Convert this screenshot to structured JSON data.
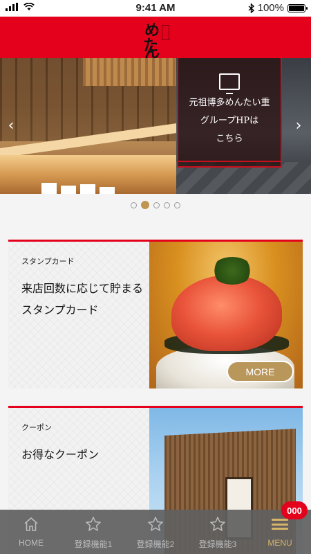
{
  "status_bar": {
    "time": "9:41 AM",
    "battery_percent": "100%"
  },
  "header": {
    "logo_text_1": "めん",
    "logo_text_2": "た重",
    "brand_color": "#e4011b"
  },
  "banner": {
    "overlay_line1": "元祖博多めんたい重",
    "overlay_line2": "グループHPは",
    "overlay_line3": "こちら",
    "prev_glyph": "‹",
    "next_glyph": "›",
    "dots_count": 5,
    "active_index": 1
  },
  "cards": [
    {
      "kicker": "スタンプカード",
      "title": "来店回数に応じて貯まるスタンプカード",
      "button_label": "MORE",
      "image": "mentaiko-rice-photo"
    },
    {
      "kicker": "クーポン",
      "title": "お得なクーポン",
      "image": "wooden-building-photo"
    }
  ],
  "tab_bar": {
    "tabs": [
      {
        "label": "HOME",
        "icon": "home-icon"
      },
      {
        "label": "登録機能1",
        "icon": "star-icon"
      },
      {
        "label": "登録機能2",
        "icon": "star-icon"
      },
      {
        "label": "登録機能3",
        "icon": "star-icon"
      },
      {
        "label": "MENU",
        "icon": "menu-icon"
      }
    ],
    "badge_count": "000",
    "accent_color": "#d6b46a"
  }
}
